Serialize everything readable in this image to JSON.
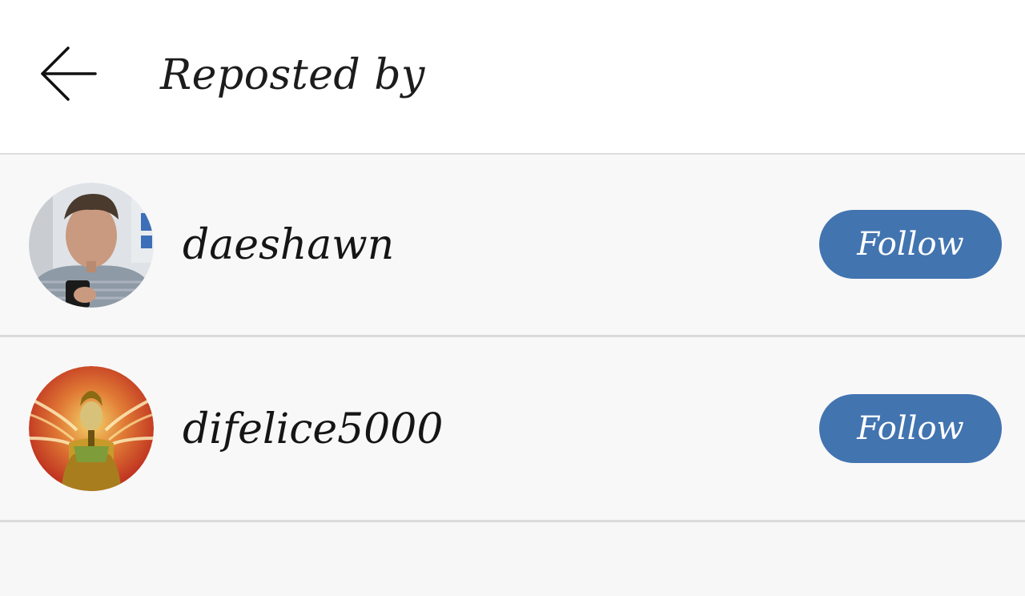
{
  "header": {
    "title": "Reposted by",
    "back_icon": "arrow-left-icon"
  },
  "reposters": [
    {
      "username": "daeshawn",
      "follow_label": "Follow",
      "avatar": "profile-photo"
    },
    {
      "username": "difelice5000",
      "follow_label": "Follow",
      "avatar": "profile-artwork"
    }
  ],
  "colors": {
    "accent": "#4274b0",
    "header_bg": "#ffffff",
    "list_bg": "#f8f8f8",
    "divider": "#dadada"
  }
}
